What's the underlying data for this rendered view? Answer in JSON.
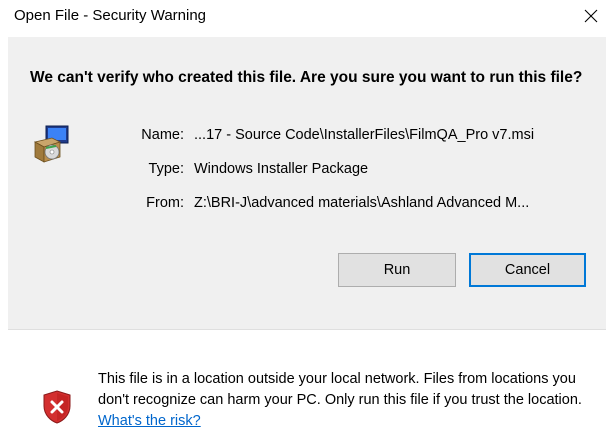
{
  "window": {
    "title": "Open File - Security Warning",
    "close_glyph": "close-icon"
  },
  "prompt": {
    "heading": "We can't verify who created this file. Are you sure you want to run this file?"
  },
  "file": {
    "icon": "installer-package-icon",
    "name_label": "Name:",
    "name_value": "...17 - Source Code\\InstallerFiles\\FilmQA_Pro v7.msi",
    "type_label": "Type:",
    "type_value": "Windows Installer Package",
    "from_label": "From:",
    "from_value": "Z:\\BRI-J\\advanced materials\\Ashland Advanced M..."
  },
  "buttons": {
    "run_label": "Run",
    "cancel_label": "Cancel"
  },
  "footer": {
    "icon": "shield-warning-icon",
    "warning_text": "This file is in a location outside your local network. Files from locations you don't recognize can harm your PC. Only run this file if you trust the location.",
    "link_text": "What's the risk?"
  },
  "colors": {
    "panel_bg": "#f0f0f0",
    "footer_bg": "#ffffff",
    "button_bg": "#e1e1e1",
    "focus_border": "#0078d7",
    "link": "#0066cc",
    "shield_red": "#d32f2f"
  }
}
